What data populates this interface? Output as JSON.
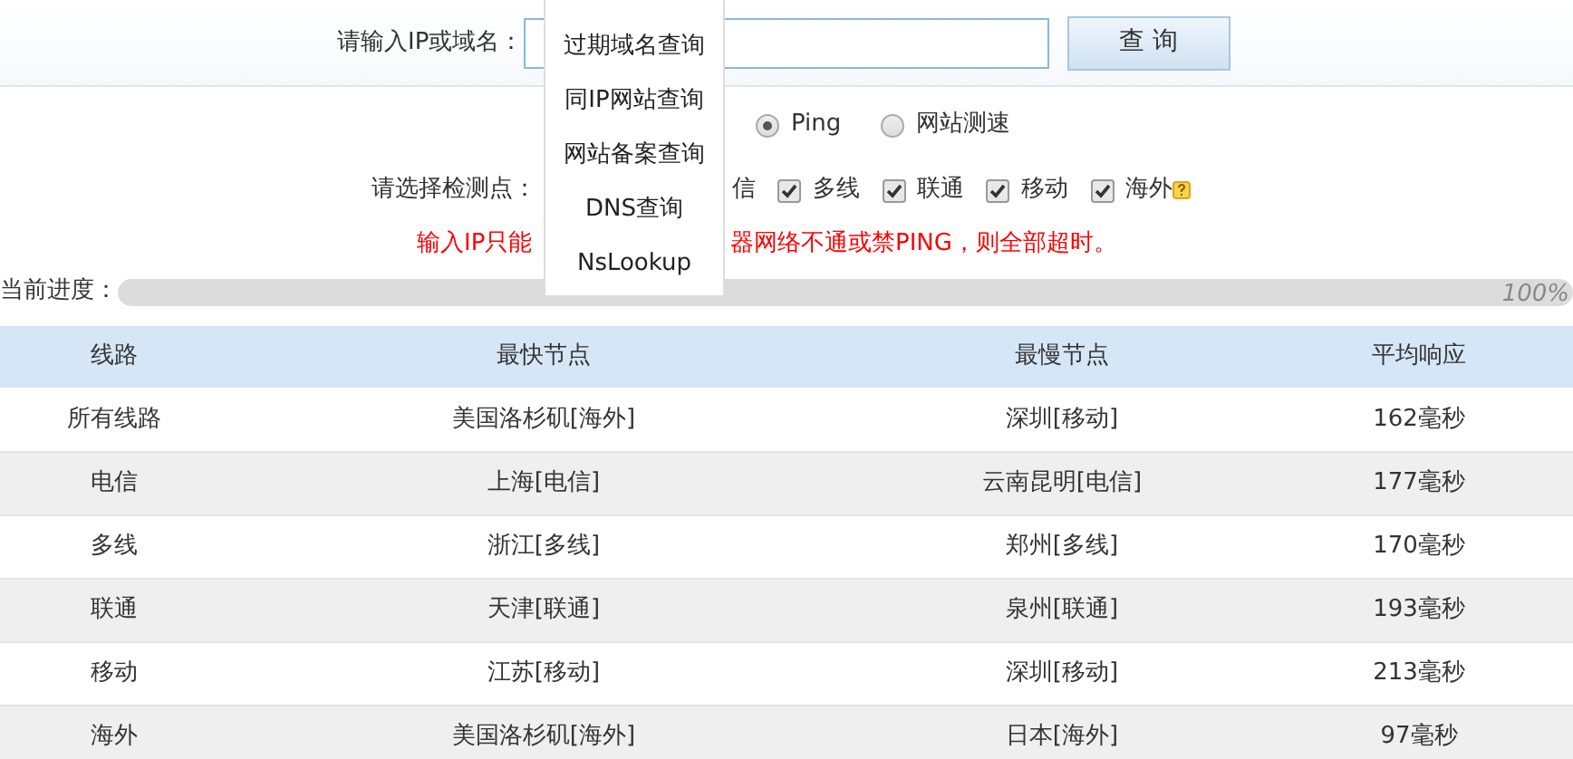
{
  "query": {
    "label": "请输入IP或域名：",
    "button": "查 询"
  },
  "mode_options": [
    {
      "label": "Ping",
      "selected": true
    },
    {
      "label": "网站测速",
      "selected": false
    }
  ],
  "nodes": {
    "label": "请选择检测点：",
    "items": [
      {
        "label": "信",
        "kind": "partial"
      },
      {
        "label": "多线",
        "checked": true,
        "kind": "checkbox"
      },
      {
        "label": "联通",
        "checked": true,
        "kind": "checkbox"
      },
      {
        "label": "移动",
        "checked": true,
        "kind": "checkbox"
      },
      {
        "label": "海外",
        "checked": true,
        "kind": "checkbox"
      }
    ]
  },
  "warning": [
    "输入IP只能",
    "器网络不通或禁PING，则全部超时。"
  ],
  "progress": {
    "label": "当前进度：",
    "level": 1,
    "reading": "100%"
  },
  "menu": [
    "过期域名查询",
    "同IP网站查询",
    "网站备案查询",
    "DNS查询",
    "NsLookup"
  ],
  "table": {
    "columns": [
      "线路",
      "最快节点",
      "最慢节点",
      "平均响应"
    ],
    "rows": [
      [
        "所有线路",
        "美国洛杉矶[海外]",
        "深圳[移动]",
        "162毫秒"
      ],
      [
        "电信",
        "上海[电信]",
        "云南昆明[电信]",
        "177毫秒"
      ],
      [
        "多线",
        "浙江[多线]",
        "郑州[多线]",
        "170毫秒"
      ],
      [
        "联通",
        "天津[联通]",
        "泉州[联通]",
        "193毫秒"
      ],
      [
        "移动",
        "江苏[移动]",
        "深圳[移动]",
        "213毫秒"
      ],
      [
        "海外",
        "美国洛杉矶[海外]",
        "日本[海外]",
        "97毫秒"
      ]
    ]
  }
}
